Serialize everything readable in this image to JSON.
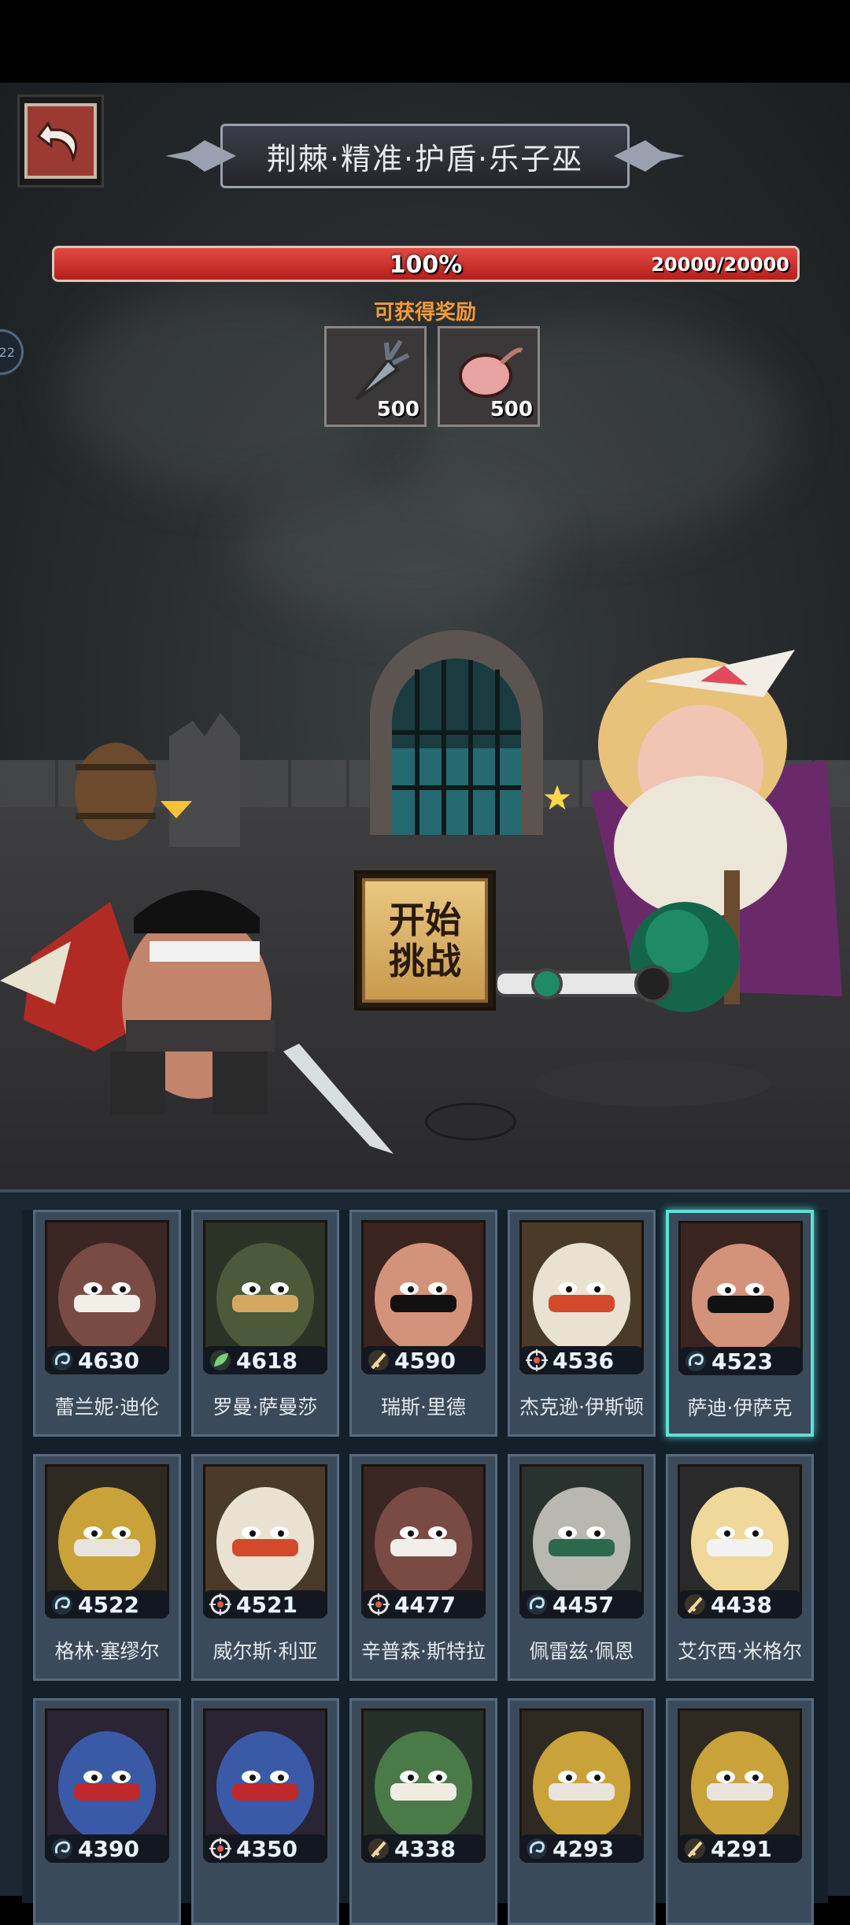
{
  "stage": {
    "title": "荆棘·精准·护盾·乐子巫",
    "hp_percent_label": "100%",
    "hp_value_label": "20000/20000",
    "hp_fraction": 1.0
  },
  "rewards": {
    "label": "可获得奖励",
    "items": [
      {
        "icon": "carrot-icon",
        "count": "500"
      },
      {
        "icon": "onion-bulb-icon",
        "count": "500"
      }
    ]
  },
  "start_button": {
    "label": "开始挑战"
  },
  "side_tab": {
    "label": "22"
  },
  "colors": {
    "hp_bar": "#c8302b",
    "reward_label": "#f39a38",
    "selected_card": "#5fe0d8",
    "start_button": "#d9b06a"
  },
  "heroes": [
    {
      "name": "蕾兰妮·迪伦",
      "power": "4630",
      "class_icon": "wind-class-icon",
      "palette": "hippo",
      "selected": false
    },
    {
      "name": "罗曼·萨曼莎",
      "power": "4618",
      "class_icon": "leaf-class-icon",
      "palette": "hood",
      "selected": false
    },
    {
      "name": "瑞斯·里德",
      "power": "4590",
      "class_icon": "sword-class-icon",
      "palette": "pirate",
      "selected": false
    },
    {
      "name": "杰克逊·伊斯顿",
      "power": "4536",
      "class_icon": "target-class-icon",
      "palette": "chicken",
      "selected": false
    },
    {
      "name": "萨迪·伊萨克",
      "power": "4523",
      "class_icon": "wind-class-icon",
      "palette": "pirate",
      "selected": true
    },
    {
      "name": "格林·塞缪尔",
      "power": "4522",
      "class_icon": "wind-class-icon",
      "palette": "goldmask",
      "selected": false
    },
    {
      "name": "威尔斯·利亚",
      "power": "4521",
      "class_icon": "target-class-icon",
      "palette": "chicken",
      "selected": false
    },
    {
      "name": "辛普森·斯特拉",
      "power": "4477",
      "class_icon": "target-class-icon",
      "palette": "hippo",
      "selected": false
    },
    {
      "name": "佩雷兹·佩恩",
      "power": "4457",
      "class_icon": "wind-class-icon",
      "palette": "skull",
      "selected": false
    },
    {
      "name": "艾尔西·米格尔",
      "power": "4438",
      "class_icon": "sword-class-icon",
      "palette": "panda",
      "selected": false
    },
    {
      "name": "",
      "power": "4390",
      "class_icon": "wind-class-icon",
      "palette": "redhair",
      "selected": false
    },
    {
      "name": "",
      "power": "4350",
      "class_icon": "target-class-icon",
      "palette": "redhair",
      "selected": false
    },
    {
      "name": "",
      "power": "4338",
      "class_icon": "sword-class-icon",
      "palette": "croc",
      "selected": false
    },
    {
      "name": "",
      "power": "4293",
      "class_icon": "wind-class-icon",
      "palette": "goldmask",
      "selected": false
    },
    {
      "name": "",
      "power": "4291",
      "class_icon": "sword-class-icon",
      "palette": "goldmask",
      "selected": false
    }
  ]
}
